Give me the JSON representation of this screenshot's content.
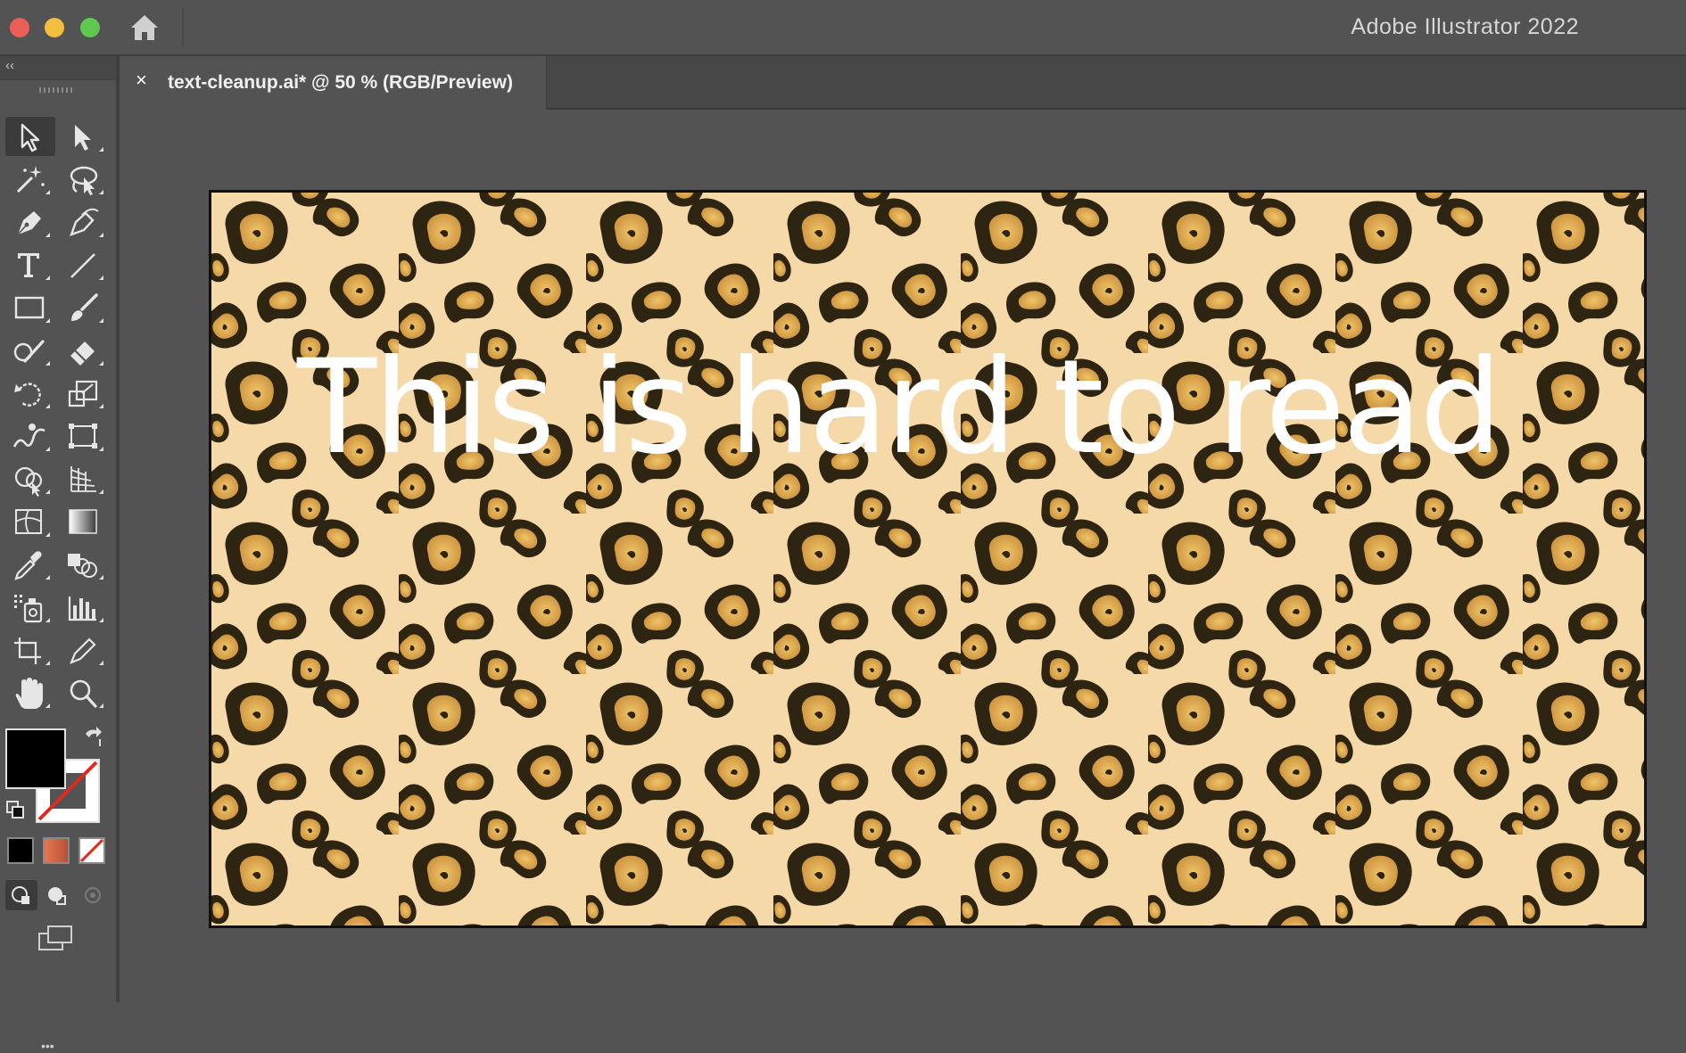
{
  "window": {
    "app_title": "Adobe Illustrator 2022",
    "traffic_light_colors": [
      "#ec5f57",
      "#f4be3f",
      "#5fc84f"
    ]
  },
  "toolbar": {
    "collapse_label": "‹‹",
    "tools": [
      {
        "name": "selection-tool",
        "icon": "arrow-icon",
        "active": true
      },
      {
        "name": "direct-selection-tool",
        "icon": "filled-arrow-icon"
      },
      {
        "name": "magic-wand-tool",
        "icon": "magic-wand-icon"
      },
      {
        "name": "lasso-tool",
        "icon": "lasso-icon"
      },
      {
        "name": "pen-tool",
        "icon": "pen-icon"
      },
      {
        "name": "curvature-tool",
        "icon": "curvature-pen-icon"
      },
      {
        "name": "type-tool",
        "icon": "type-icon"
      },
      {
        "name": "line-segment-tool",
        "icon": "line-icon"
      },
      {
        "name": "rectangle-tool",
        "icon": "rectangle-icon"
      },
      {
        "name": "paintbrush-tool",
        "icon": "brush-icon"
      },
      {
        "name": "shaper-tool",
        "icon": "shaper-icon"
      },
      {
        "name": "eraser-tool",
        "icon": "eraser-icon"
      },
      {
        "name": "rotate-tool",
        "icon": "rotate-icon"
      },
      {
        "name": "scale-tool",
        "icon": "scale-icon"
      },
      {
        "name": "warp-tool",
        "icon": "warp-icon"
      },
      {
        "name": "free-transform-tool",
        "icon": "free-transform-icon"
      },
      {
        "name": "shape-builder-tool",
        "icon": "shape-builder-icon"
      },
      {
        "name": "perspective-grid-tool",
        "icon": "perspective-grid-icon"
      },
      {
        "name": "mesh-tool",
        "icon": "mesh-icon"
      },
      {
        "name": "gradient-tool",
        "icon": "gradient-icon"
      },
      {
        "name": "eyedropper-tool",
        "icon": "eyedropper-icon"
      },
      {
        "name": "blend-tool",
        "icon": "blend-icon"
      },
      {
        "name": "symbol-sprayer-tool",
        "icon": "symbol-sprayer-icon"
      },
      {
        "name": "column-graph-tool",
        "icon": "column-graph-icon"
      },
      {
        "name": "artboard-tool",
        "icon": "artboard-icon"
      },
      {
        "name": "slice-tool",
        "icon": "slice-icon"
      },
      {
        "name": "hand-tool",
        "icon": "hand-icon"
      },
      {
        "name": "zoom-tool",
        "icon": "zoom-icon"
      }
    ],
    "fill_color": "#000000",
    "stroke_color": "none",
    "more_label": "•••"
  },
  "document": {
    "tab_close": "×",
    "tab_label": "text-cleanup.ai* @ 50 % (RGB/Preview)"
  },
  "artboard": {
    "text": "This is hard to read",
    "pattern": "leopard-print",
    "colors": {
      "background": "#f5d9a8",
      "spot_dark": "#2e2412",
      "spot_center": "#d9a54d",
      "text": "#ffffff"
    }
  }
}
